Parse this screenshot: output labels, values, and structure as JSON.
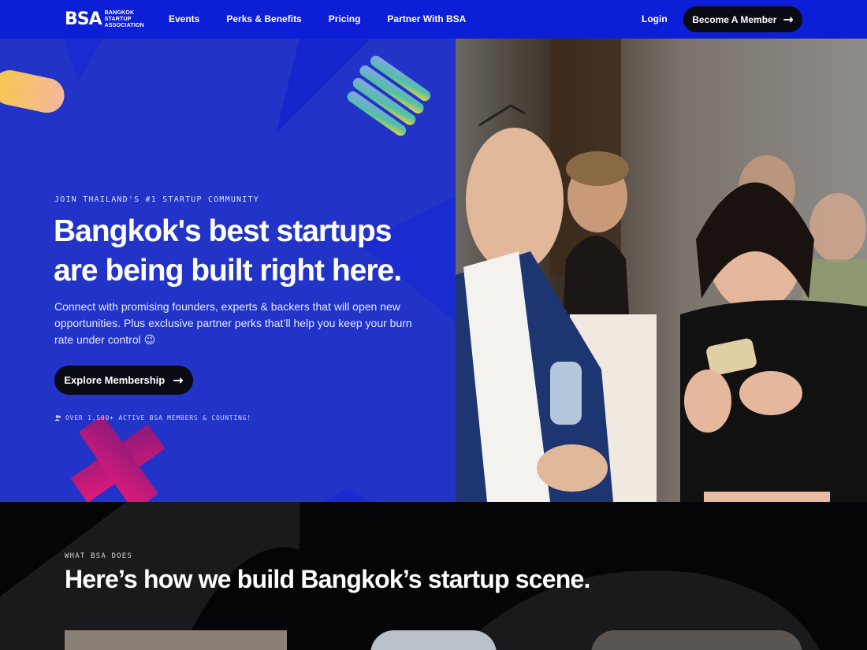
{
  "nav": {
    "logo_mark": "BSA",
    "logo_text": [
      "Bangkok",
      "Startup",
      "Association"
    ],
    "links": [
      "Events",
      "Perks & Benefits",
      "Pricing",
      "Partner With BSA"
    ],
    "login": "Login",
    "cta": "Become A Member"
  },
  "hero": {
    "eyebrow": "Join Thailand's #1 startup community",
    "headline_line1": "Bangkok's best startups",
    "headline_line2": "are being built right here.",
    "subtext": "Connect with promising founders, experts & backers that will open new opportunities. Plus exclusive partner perks that’ll help you keep your burn rate under control 😉",
    "cta": "Explore Membership",
    "members_note": "Over 1,500+ active BSA members & counting!"
  },
  "section2": {
    "eyebrow": "What BSA does",
    "title": "Here’s how we build Bangkok’s startup scene."
  },
  "colors": {
    "nav_bg": "#0d1fd6",
    "hero_bg": "#2233c8",
    "dark_button": "#0a0a14",
    "section_bg": "#050507"
  },
  "icons": [
    "arrow-right-icon",
    "user-group-icon"
  ]
}
